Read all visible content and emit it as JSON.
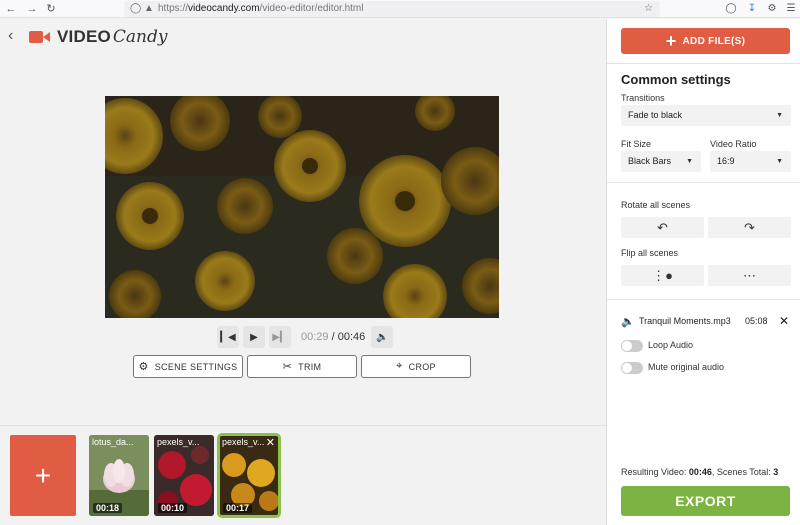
{
  "browser": {
    "url_prefix": "https://",
    "url_domain": "videocandy.com",
    "url_path": "/video-editor/editor.html"
  },
  "header": {
    "logo_video": "VIDEO",
    "logo_candy": "Candy"
  },
  "player": {
    "current_time": "00:29",
    "separator": " / ",
    "total_time": "00:46"
  },
  "actions": {
    "scene_settings": "SCENE SETTINGS",
    "trim": "TRIM",
    "crop": "CROP"
  },
  "timeline": {
    "add_label": "+",
    "clips": [
      {
        "name": "lotus_da...",
        "duration": "00:18",
        "selected": false
      },
      {
        "name": "pexels_v...",
        "duration": "00:10",
        "selected": false
      },
      {
        "name": "pexels_v...",
        "duration": "00:17",
        "selected": true
      }
    ],
    "close_glyph": "✕"
  },
  "panel": {
    "add_files": "ADD FILE(S)",
    "common_settings": "Common settings",
    "transitions_label": "Transitions",
    "transitions_value": "Fade to black",
    "fit_size_label": "Fit Size",
    "fit_size_value": "Black Bars",
    "video_ratio_label": "Video Ratio",
    "video_ratio_value": "16:9",
    "rotate_label": "Rotate all scenes",
    "flip_label": "Flip all scenes",
    "audio_file": "Tranquil Moments.mp3",
    "audio_duration": "05:08",
    "loop_audio": "Loop Audio",
    "mute_audio": "Mute original audio",
    "loop_audio_on": false,
    "mute_audio_on": false,
    "result_label": "Resulting Video: ",
    "result_duration": "00:46",
    "result_scenes_label": ", Scenes Total: ",
    "result_scenes": "3",
    "export": "EXPORT"
  },
  "colors": {
    "brand": "#e05d44",
    "export": "#7cb342",
    "selected_clip": "#8bc34a"
  }
}
